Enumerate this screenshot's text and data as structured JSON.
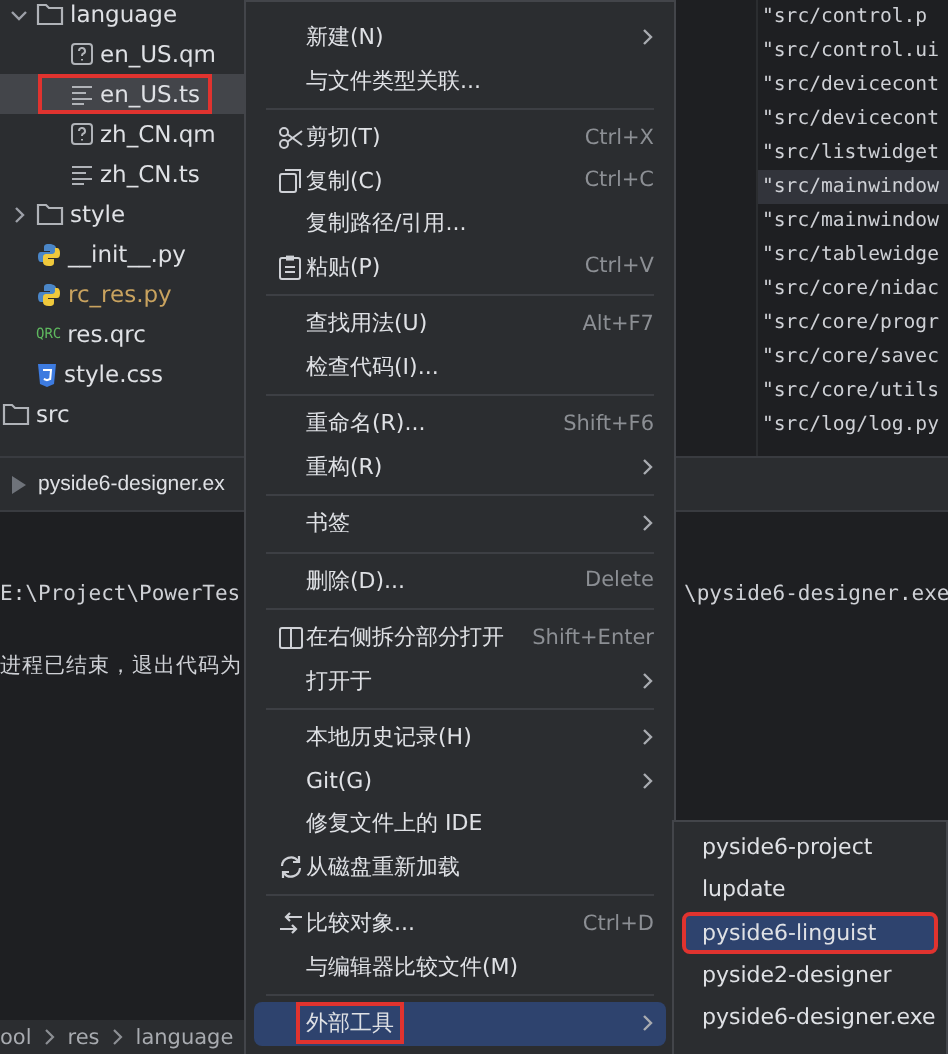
{
  "project_tree": {
    "items": [
      {
        "label": "language",
        "kind": "folder",
        "expanded": true,
        "selected": false,
        "marked": false,
        "children": [
          {
            "label": "en_US.qm",
            "kind": "qm",
            "selected": false,
            "marked": false
          },
          {
            "label": "en_US.ts",
            "kind": "ts",
            "selected": true,
            "marked": true
          },
          {
            "label": "zh_CN.qm",
            "kind": "qm",
            "selected": false,
            "marked": false
          },
          {
            "label": "zh_CN.ts",
            "kind": "ts",
            "selected": false,
            "marked": false
          }
        ]
      },
      {
        "label": "style",
        "kind": "folder",
        "expanded": false,
        "selected": false,
        "marked": false
      },
      {
        "label": "__init__.py",
        "kind": "python",
        "selected": false,
        "marked": false
      },
      {
        "label": "rc_res.py",
        "kind": "python",
        "color": "#c9a35f",
        "selected": false,
        "marked": false
      },
      {
        "label": "res.qrc",
        "kind": "qrc",
        "badge": "QRC",
        "selected": false,
        "marked": false
      },
      {
        "label": "style.css",
        "kind": "css",
        "selected": false,
        "marked": false
      }
    ],
    "parent_level_items": [
      {
        "label": "src",
        "kind": "folder",
        "selected": false,
        "marked": false
      }
    ]
  },
  "editor_lines": [
    {
      "text": "\"src/control.p",
      "current": false
    },
    {
      "text": "\"src/control.ui",
      "current": false
    },
    {
      "text": "\"src/devicecont",
      "current": false
    },
    {
      "text": "\"src/devicecont",
      "current": false
    },
    {
      "text": "\"src/listwidget",
      "current": false
    },
    {
      "text": "\"src/mainwindow",
      "current": true
    },
    {
      "text": "\"src/mainwindow",
      "current": false
    },
    {
      "text": "\"src/tablewidge",
      "current": false
    },
    {
      "text": "\"src/core/nidac",
      "current": false
    },
    {
      "text": "\"src/core/progr",
      "current": false
    },
    {
      "text": "\"src/core/savec",
      "current": false
    },
    {
      "text": "\"src/core/utils",
      "current": false
    },
    {
      "text": "\"src/log/log.py",
      "current": false
    }
  ],
  "run_tab": {
    "label": "pyside6-designer.ex"
  },
  "console": {
    "left_lines": [
      "E:\\Project\\PowerTes",
      "进程已结束，退出代码为"
    ],
    "right_lines": [
      "\\pyside6-designer.exe"
    ]
  },
  "breadcrumb": [
    "ool",
    "res",
    "language"
  ],
  "context_menu": {
    "items": [
      {
        "kind": "item",
        "label": "新建(N)",
        "submenu": true,
        "selected": false,
        "marked": false
      },
      {
        "kind": "item",
        "label": "与文件类型关联...",
        "selected": false,
        "marked": false
      },
      {
        "kind": "separator"
      },
      {
        "kind": "cut",
        "label": "剪切(T)",
        "shortcut": "Ctrl+X",
        "selected": false,
        "marked": false
      },
      {
        "kind": "copy",
        "label": "复制(C)",
        "shortcut": "Ctrl+C",
        "selected": false,
        "marked": false
      },
      {
        "kind": "item",
        "label": "复制路径/引用...",
        "selected": false,
        "marked": false
      },
      {
        "kind": "paste",
        "label": "粘贴(P)",
        "shortcut": "Ctrl+V",
        "selected": false,
        "marked": false
      },
      {
        "kind": "separator"
      },
      {
        "kind": "item",
        "label": "查找用法(U)",
        "shortcut": "Alt+F7",
        "selected": false,
        "marked": false
      },
      {
        "kind": "item",
        "label": "检查代码(I)...",
        "selected": false,
        "marked": false
      },
      {
        "kind": "separator"
      },
      {
        "kind": "item",
        "label": "重命名(R)...",
        "shortcut": "Shift+F6",
        "selected": false,
        "marked": false
      },
      {
        "kind": "item",
        "label": "重构(R)",
        "submenu": true,
        "selected": false,
        "marked": false
      },
      {
        "kind": "separator"
      },
      {
        "kind": "item",
        "label": "书签",
        "submenu": true,
        "selected": false,
        "marked": false
      },
      {
        "kind": "separator"
      },
      {
        "kind": "item",
        "label": "删除(D)...",
        "shortcut": "Delete",
        "selected": false,
        "marked": false
      },
      {
        "kind": "separator"
      },
      {
        "kind": "split",
        "label": "在右侧拆分部分打开",
        "shortcut": "Shift+Enter",
        "selected": false,
        "marked": false
      },
      {
        "kind": "item",
        "label": "打开于",
        "submenu": true,
        "selected": false,
        "marked": false
      },
      {
        "kind": "separator"
      },
      {
        "kind": "item",
        "label": "本地历史记录(H)",
        "submenu": true,
        "selected": false,
        "marked": false
      },
      {
        "kind": "item",
        "label": "Git(G)",
        "submenu": true,
        "selected": false,
        "marked": false
      },
      {
        "kind": "item",
        "label": "修复文件上的 IDE",
        "selected": false,
        "marked": false
      },
      {
        "kind": "reload",
        "label": "从磁盘重新加载",
        "selected": false,
        "marked": false
      },
      {
        "kind": "separator"
      },
      {
        "kind": "compare",
        "label": "比较对象...",
        "shortcut": "Ctrl+D",
        "selected": false,
        "marked": false
      },
      {
        "kind": "item",
        "label": "与编辑器比较文件(M)",
        "selected": false,
        "marked": false
      },
      {
        "kind": "separator"
      },
      {
        "kind": "item",
        "label": "外部工具",
        "submenu": true,
        "selected": true,
        "marked": true
      }
    ]
  },
  "submenu": {
    "items": [
      {
        "label": "pyside6-project",
        "selected": false,
        "marked": false
      },
      {
        "label": "lupdate",
        "selected": false,
        "marked": false
      },
      {
        "label": "pyside6-linguist",
        "selected": true,
        "marked": true
      },
      {
        "label": "pyside2-designer",
        "selected": false,
        "marked": false
      },
      {
        "label": "pyside6-designer.exe",
        "selected": false,
        "marked": false
      }
    ]
  }
}
